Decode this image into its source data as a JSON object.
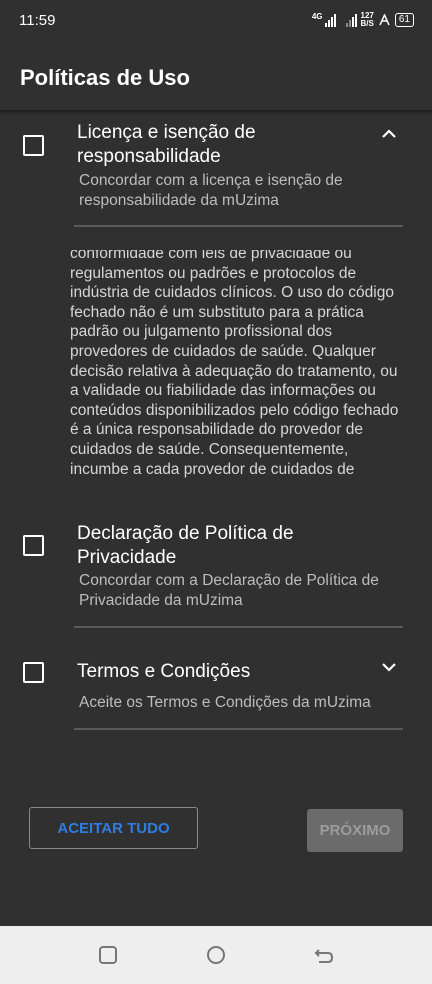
{
  "status_bar": {
    "time": "11:59",
    "network_type": "4G",
    "speed_value": "127",
    "speed_unit": "B/S",
    "battery": "61"
  },
  "app_bar": {
    "title": "Políticas de Uso"
  },
  "sections": [
    {
      "title": "Licença e isenção de responsabilidade",
      "subtitle": "Concordar com a licença e isenção de responsabilidade da mUzima",
      "expanded": true,
      "chevron_icon": "chevron-up-icon",
      "body": "conformidade com leis de privacidade ou regulamentos ou padrões e protocolos de indústria de cuidados clínicos. O uso do código fechado não é um substituto para a prática padrão ou julgamento profissional dos provedores de cuidados de saúde. Qualquer decisão relativa à adequação do tratamento, ou a validade ou fiabilidade das informações ou conteúdos disponibilizados pelo código fechado é a única responsabilidade do provedor de cuidados de saúde. Consequentemente, incumbe a cada provedor de cuidados de"
    },
    {
      "title": "Declaração de Política de Privacidade",
      "subtitle": "Concordar com a Declaração de Política de Privacidade da mUzima"
    },
    {
      "title": "Termos e Condições",
      "subtitle": "Aceite os Termos e Condições da mUzima",
      "expanded": false,
      "chevron_icon": "chevron-down-icon"
    }
  ],
  "buttons": {
    "accept_all": "ACEITAR TUDO",
    "next": "PRÓXIMO"
  },
  "colors": {
    "background": "#303030",
    "accent": "#2f7de1",
    "nav_background": "#eeeeee",
    "disabled_button": "#6b6b6b"
  }
}
